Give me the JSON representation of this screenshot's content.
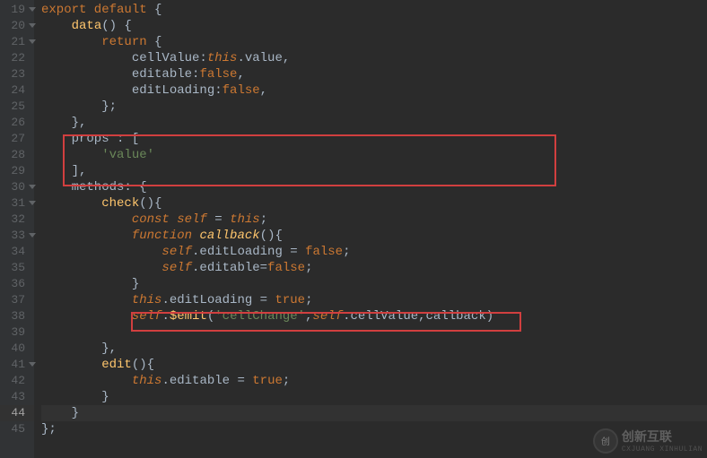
{
  "lines": [
    {
      "num": "19",
      "fold": true,
      "tokens": [
        {
          "t": "export default ",
          "c": "kw"
        },
        {
          "t": "{",
          "c": "punct"
        }
      ]
    },
    {
      "num": "20",
      "fold": true,
      "tokens": [
        {
          "t": "    ",
          "c": ""
        },
        {
          "t": "data",
          "c": "fn"
        },
        {
          "t": "() {",
          "c": "punct"
        }
      ]
    },
    {
      "num": "21",
      "fold": true,
      "tokens": [
        {
          "t": "        ",
          "c": ""
        },
        {
          "t": "return ",
          "c": "kw"
        },
        {
          "t": "{",
          "c": "punct"
        }
      ]
    },
    {
      "num": "22",
      "fold": false,
      "tokens": [
        {
          "t": "            cellValue:",
          "c": "prop"
        },
        {
          "t": "this",
          "c": "this"
        },
        {
          "t": ".value,",
          "c": "prop"
        }
      ]
    },
    {
      "num": "23",
      "fold": false,
      "tokens": [
        {
          "t": "            editable:",
          "c": "prop"
        },
        {
          "t": "false",
          "c": "kw"
        },
        {
          "t": ",",
          "c": "punct"
        }
      ]
    },
    {
      "num": "24",
      "fold": false,
      "tokens": [
        {
          "t": "            editLoading:",
          "c": "prop"
        },
        {
          "t": "false",
          "c": "kw"
        },
        {
          "t": ",",
          "c": "punct"
        }
      ]
    },
    {
      "num": "25",
      "fold": false,
      "tokens": [
        {
          "t": "        };",
          "c": "punct"
        }
      ]
    },
    {
      "num": "26",
      "fold": false,
      "tokens": [
        {
          "t": "    },",
          "c": "punct"
        }
      ]
    },
    {
      "num": "27",
      "fold": false,
      "tokens": [
        {
          "t": "    props : [",
          "c": "prop"
        }
      ]
    },
    {
      "num": "28",
      "fold": false,
      "tokens": [
        {
          "t": "        ",
          "c": ""
        },
        {
          "t": "'value'",
          "c": "str"
        }
      ]
    },
    {
      "num": "29",
      "fold": false,
      "tokens": [
        {
          "t": "    ],",
          "c": "punct"
        }
      ]
    },
    {
      "num": "30",
      "fold": true,
      "tokens": [
        {
          "t": "    methods: {",
          "c": "prop"
        }
      ]
    },
    {
      "num": "31",
      "fold": true,
      "tokens": [
        {
          "t": "        ",
          "c": ""
        },
        {
          "t": "check",
          "c": "fn"
        },
        {
          "t": "(){",
          "c": "punct"
        }
      ]
    },
    {
      "num": "32",
      "fold": false,
      "tokens": [
        {
          "t": "            ",
          "c": ""
        },
        {
          "t": "const ",
          "c": "kw-italic"
        },
        {
          "t": "self",
          "c": "self"
        },
        {
          "t": " = ",
          "c": "punct"
        },
        {
          "t": "this",
          "c": "this"
        },
        {
          "t": ";",
          "c": "punct"
        }
      ]
    },
    {
      "num": "33",
      "fold": true,
      "tokens": [
        {
          "t": "            ",
          "c": ""
        },
        {
          "t": "function ",
          "c": "kw-italic"
        },
        {
          "t": "callback",
          "c": "fn-italic"
        },
        {
          "t": "(){",
          "c": "punct"
        }
      ]
    },
    {
      "num": "34",
      "fold": false,
      "tokens": [
        {
          "t": "                ",
          "c": ""
        },
        {
          "t": "self",
          "c": "self"
        },
        {
          "t": ".editLoading = ",
          "c": "prop"
        },
        {
          "t": "false",
          "c": "kw"
        },
        {
          "t": ";",
          "c": "punct"
        }
      ]
    },
    {
      "num": "35",
      "fold": false,
      "tokens": [
        {
          "t": "                ",
          "c": ""
        },
        {
          "t": "self",
          "c": "self"
        },
        {
          "t": ".editable=",
          "c": "prop"
        },
        {
          "t": "false",
          "c": "kw"
        },
        {
          "t": ";",
          "c": "punct"
        }
      ]
    },
    {
      "num": "36",
      "fold": false,
      "tokens": [
        {
          "t": "            }",
          "c": "punct"
        }
      ]
    },
    {
      "num": "37",
      "fold": false,
      "tokens": [
        {
          "t": "            ",
          "c": ""
        },
        {
          "t": "this",
          "c": "this"
        },
        {
          "t": ".editLoading = ",
          "c": "prop"
        },
        {
          "t": "true",
          "c": "kw"
        },
        {
          "t": ";",
          "c": "punct"
        }
      ]
    },
    {
      "num": "38",
      "fold": false,
      "tokens": [
        {
          "t": "            ",
          "c": ""
        },
        {
          "t": "self",
          "c": "self"
        },
        {
          "t": ".",
          "c": "punct"
        },
        {
          "t": "$emit",
          "c": "fn"
        },
        {
          "t": "(",
          "c": "punct"
        },
        {
          "t": "'cellChange'",
          "c": "str"
        },
        {
          "t": ",",
          "c": "punct"
        },
        {
          "t": "self",
          "c": "self"
        },
        {
          "t": ".cellValue,callback)",
          "c": "prop"
        }
      ]
    },
    {
      "num": "39",
      "fold": false,
      "tokens": []
    },
    {
      "num": "40",
      "fold": false,
      "tokens": [
        {
          "t": "        },",
          "c": "punct"
        }
      ]
    },
    {
      "num": "41",
      "fold": true,
      "tokens": [
        {
          "t": "        ",
          "c": ""
        },
        {
          "t": "edit",
          "c": "fn"
        },
        {
          "t": "(){",
          "c": "punct"
        }
      ]
    },
    {
      "num": "42",
      "fold": false,
      "tokens": [
        {
          "t": "            ",
          "c": ""
        },
        {
          "t": "this",
          "c": "this"
        },
        {
          "t": ".editable = ",
          "c": "prop"
        },
        {
          "t": "true",
          "c": "kw"
        },
        {
          "t": ";",
          "c": "punct"
        }
      ]
    },
    {
      "num": "43",
      "fold": false,
      "tokens": [
        {
          "t": "        }",
          "c": "punct"
        }
      ]
    },
    {
      "num": "44",
      "fold": false,
      "highlight": true,
      "tokens": [
        {
          "t": "    }",
          "c": "punct"
        }
      ]
    },
    {
      "num": "45",
      "fold": false,
      "tokens": [
        {
          "t": "};",
          "c": "punct"
        }
      ]
    }
  ],
  "watermark": {
    "main": "创新互联",
    "sub": "CXJUANG XINHULIAN"
  }
}
